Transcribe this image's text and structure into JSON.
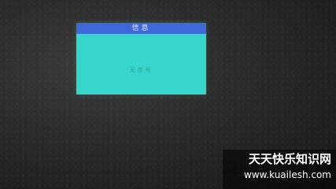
{
  "dialog": {
    "title": "信息",
    "message": "无信号"
  },
  "watermark": {
    "line1": "天天快乐知识网",
    "line2": "www.kuailesh.com"
  },
  "colors": {
    "dialog_background": "#37d6cc",
    "title_bar": "#3e69d8",
    "screen_background": "#2a2a2a"
  }
}
